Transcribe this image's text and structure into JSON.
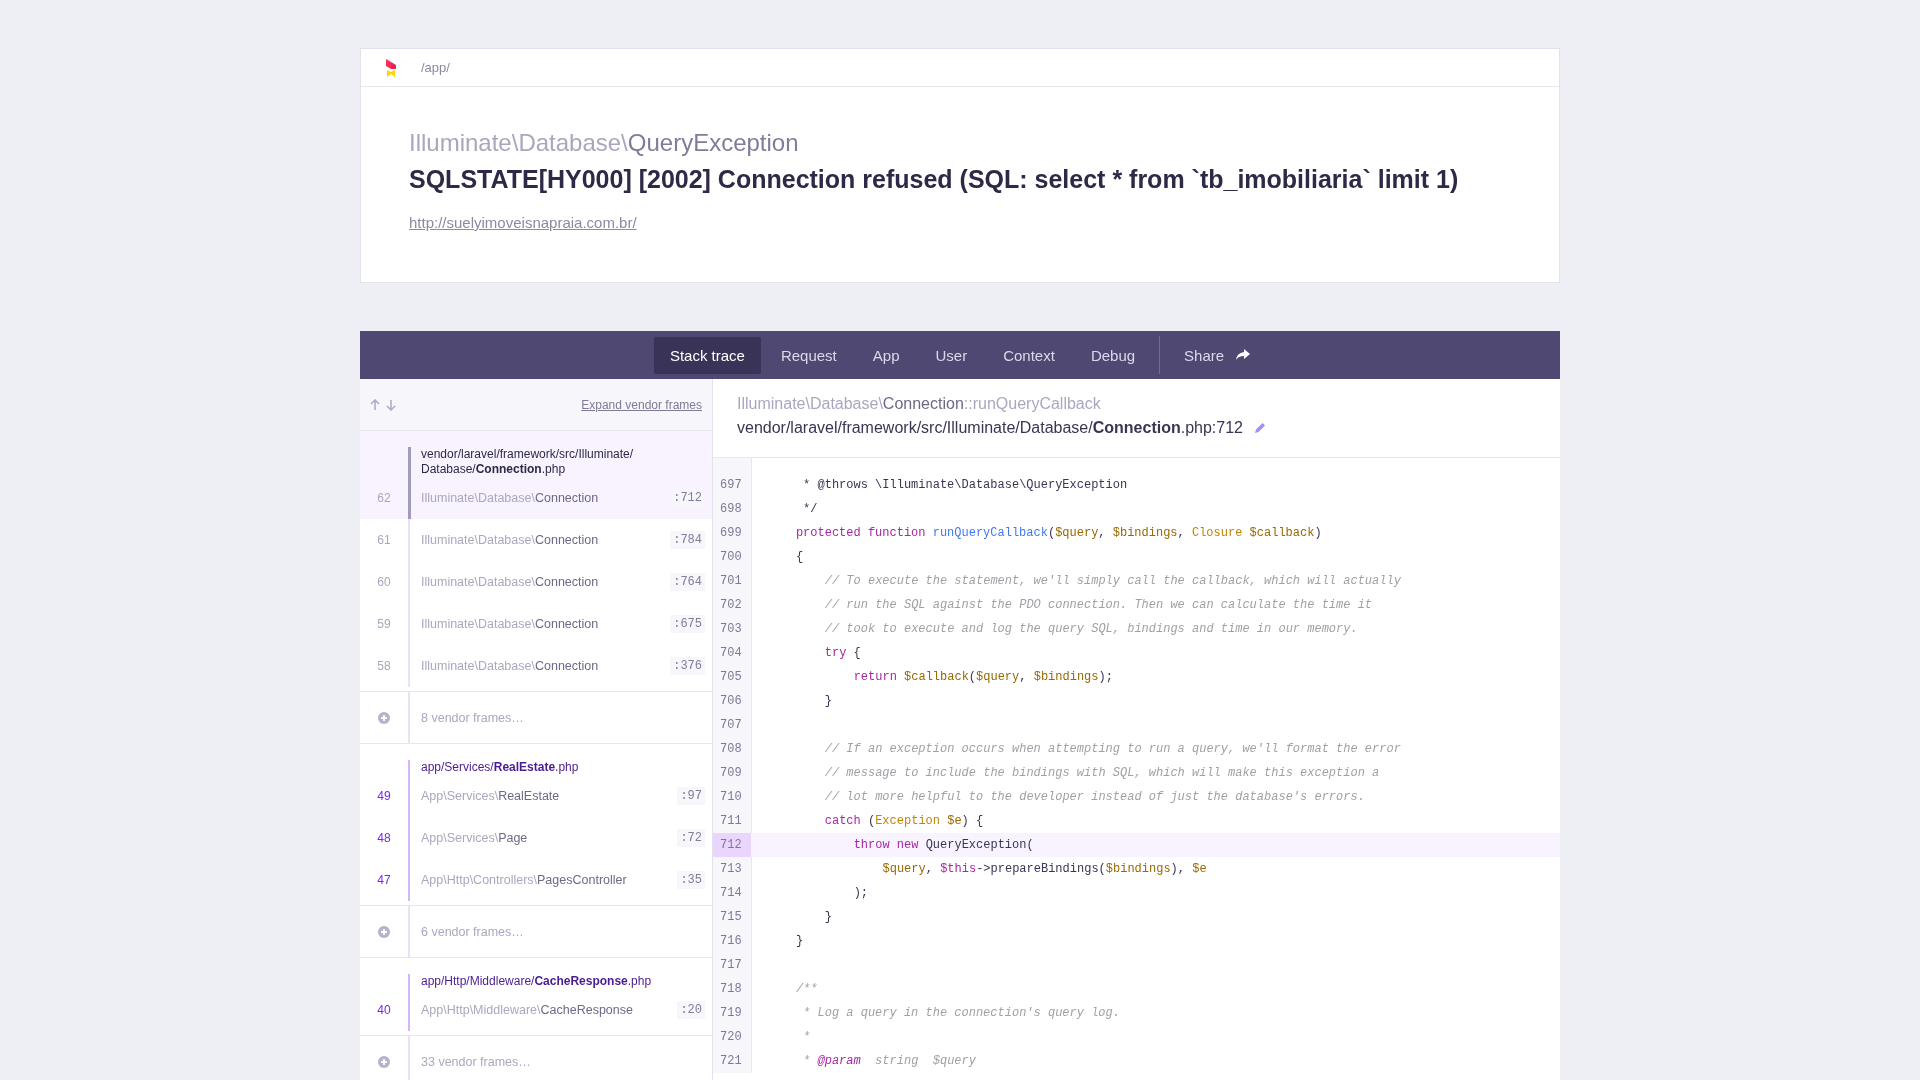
{
  "header": {
    "path": "/app/",
    "exception_namespace": "Illuminate\\Database\\",
    "exception_class": "QueryException",
    "message": "SQLSTATE[HY000] [2002] Connection refused (SQL: select * from `tb_imobiliaria` limit 1)",
    "url": "http://suelyimoveisnapraia.com.br/"
  },
  "tabs": [
    {
      "label": "Stack trace",
      "selected": true
    },
    {
      "label": "Request",
      "selected": false
    },
    {
      "label": "App",
      "selected": false
    },
    {
      "label": "User",
      "selected": false
    },
    {
      "label": "Context",
      "selected": false
    },
    {
      "label": "Debug",
      "selected": false
    }
  ],
  "share": {
    "label": "Share"
  },
  "stack": {
    "expand_label": "Expand vendor frames",
    "items": [
      {
        "kind": "frames",
        "app": false,
        "frames": [
          {
            "number": "62",
            "file": "vendor/laravel/framework/src/Illuminate/Database/**Connection**.php",
            "class_prefix": "Illuminate\\Database\\",
            "class_name": "Connection",
            "line": ":712",
            "selected": true
          },
          {
            "number": "61",
            "class_prefix": "Illuminate\\Database\\",
            "class_name": "Connection",
            "line": ":784",
            "selected": false
          },
          {
            "number": "60",
            "class_prefix": "Illuminate\\Database\\",
            "class_name": "Connection",
            "line": ":764",
            "selected": false
          },
          {
            "number": "59",
            "class_prefix": "Illuminate\\Database\\",
            "class_name": "Connection",
            "line": ":675",
            "selected": false
          },
          {
            "number": "58",
            "class_prefix": "Illuminate\\Database\\",
            "class_name": "Connection",
            "line": ":376",
            "selected": false
          }
        ]
      },
      {
        "kind": "vendor",
        "label": "8 vendor frames…"
      },
      {
        "kind": "frames",
        "app": true,
        "frames": [
          {
            "number": "49",
            "file": "app/Services/**RealEstate**.php",
            "class_prefix": "App\\Services\\",
            "class_name": "RealEstate",
            "line": ":97",
            "selected": false
          },
          {
            "number": "48",
            "class_prefix": "App\\Services\\",
            "class_name": "Page",
            "line": ":72",
            "selected": false
          },
          {
            "number": "47",
            "class_prefix": "App\\Http\\Controllers\\",
            "class_name": "PagesController",
            "line": ":35",
            "selected": false
          }
        ]
      },
      {
        "kind": "vendor",
        "label": "6 vendor frames…"
      },
      {
        "kind": "frames",
        "app": true,
        "frames": [
          {
            "number": "40",
            "file": "app/Http/Middleware/**CacheResponse**.php",
            "class_prefix": "App\\Http\\Middleware\\",
            "class_name": "CacheResponse",
            "line": ":20",
            "selected": false
          }
        ]
      },
      {
        "kind": "vendor",
        "label": "33 vendor frames…"
      }
    ]
  },
  "source": {
    "class_prefix": "Illuminate\\Database\\",
    "class_name": "Connection",
    "method": "::runQueryCallback",
    "file": "vendor/laravel/framework/src/Illuminate/Database/**Connection**.php:712",
    "lines": [
      {
        "number": "697",
        "highlighted": false,
        "tokens": [
          {
            "kind": "plain",
            "text": "     * @throws \\Illuminate\\Database\\QueryException"
          }
        ]
      },
      {
        "number": "698",
        "highlighted": false,
        "tokens": [
          {
            "kind": "plain",
            "text": "     */"
          }
        ]
      },
      {
        "number": "699",
        "highlighted": false,
        "tokens": [
          {
            "kind": "keyword",
            "text": "    protected function"
          },
          {
            "kind": "function",
            "text": " runQueryCallback"
          },
          {
            "kind": "plain",
            "text": "("
          },
          {
            "kind": "variable",
            "text": "$query"
          },
          {
            "kind": "plain",
            "text": ", "
          },
          {
            "kind": "variable",
            "text": "$bindings"
          },
          {
            "kind": "plain",
            "text": ", "
          },
          {
            "kind": "type",
            "text": "Closure"
          },
          {
            "kind": "variable",
            "text": " $callback"
          },
          {
            "kind": "plain",
            "text": ")"
          }
        ]
      },
      {
        "number": "700",
        "highlighted": false,
        "tokens": [
          {
            "kind": "plain",
            "text": "    {"
          }
        ]
      },
      {
        "number": "701",
        "highlighted": false,
        "tokens": [
          {
            "kind": "comment",
            "text": "        // To execute the statement, we'll simply call the callback, which will actually"
          }
        ]
      },
      {
        "number": "702",
        "highlighted": false,
        "tokens": [
          {
            "kind": "comment",
            "text": "        // run the SQL against the PDO connection. Then we can calculate the time it"
          }
        ]
      },
      {
        "number": "703",
        "highlighted": false,
        "tokens": [
          {
            "kind": "comment",
            "text": "        // took to execute and log the query SQL, bindings and time in our memory."
          }
        ]
      },
      {
        "number": "704",
        "highlighted": false,
        "tokens": [
          {
            "kind": "keyword",
            "text": "        try"
          },
          {
            "kind": "plain",
            "text": " {"
          }
        ]
      },
      {
        "number": "705",
        "highlighted": false,
        "tokens": [
          {
            "kind": "keyword",
            "text": "            return"
          },
          {
            "kind": "variable",
            "text": " $callback"
          },
          {
            "kind": "plain",
            "text": "("
          },
          {
            "kind": "variable",
            "text": "$query"
          },
          {
            "kind": "plain",
            "text": ", "
          },
          {
            "kind": "variable",
            "text": "$bindings"
          },
          {
            "kind": "plain",
            "text": ");"
          }
        ]
      },
      {
        "number": "706",
        "highlighted": false,
        "tokens": [
          {
            "kind": "plain",
            "text": "        }"
          }
        ]
      },
      {
        "number": "707",
        "highlighted": false
      },
      {
        "number": "708",
        "highlighted": false,
        "tokens": [
          {
            "kind": "comment",
            "text": "        // If an exception occurs when attempting to run a query, we'll format the error"
          }
        ]
      },
      {
        "number": "709",
        "highlighted": false,
        "tokens": [
          {
            "kind": "comment",
            "text": "        // message to include the bindings with SQL, which will make this exception a"
          }
        ]
      },
      {
        "number": "710",
        "highlighted": false,
        "tokens": [
          {
            "kind": "comment",
            "text": "        // lot more helpful to the developer instead of just the database's errors."
          }
        ]
      },
      {
        "number": "711",
        "highlighted": false,
        "tokens": [
          {
            "kind": "keyword",
            "text": "        catch"
          },
          {
            "kind": "plain",
            "text": " ("
          },
          {
            "kind": "type",
            "text": "Exception"
          },
          {
            "kind": "variable",
            "text": " $e"
          },
          {
            "kind": "plain",
            "text": ") {"
          }
        ]
      },
      {
        "number": "712",
        "highlighted": true,
        "tokens": [
          {
            "kind": "keyword",
            "text": "            throw new"
          },
          {
            "kind": "plain",
            "text": " QueryException("
          }
        ]
      },
      {
        "number": "713",
        "highlighted": false,
        "tokens": [
          {
            "kind": "variable",
            "text": "                $query"
          },
          {
            "kind": "plain",
            "text": ", "
          },
          {
            "kind": "keyword",
            "text": "$this"
          },
          {
            "kind": "plain",
            "text": "->prepareBindings("
          },
          {
            "kind": "variable",
            "text": "$bindings"
          },
          {
            "kind": "plain",
            "text": "), "
          },
          {
            "kind": "variable",
            "text": "$e"
          }
        ]
      },
      {
        "number": "714",
        "highlighted": false,
        "tokens": [
          {
            "kind": "plain",
            "text": "            );"
          }
        ]
      },
      {
        "number": "715",
        "highlighted": false,
        "tokens": [
          {
            "kind": "plain",
            "text": "        }"
          }
        ]
      },
      {
        "number": "716",
        "highlighted": false,
        "tokens": [
          {
            "kind": "plain",
            "text": "    }"
          }
        ]
      },
      {
        "number": "717",
        "highlighted": false
      },
      {
        "number": "718",
        "highlighted": false,
        "tokens": [
          {
            "kind": "comment",
            "text": "    /**"
          }
        ]
      },
      {
        "number": "719",
        "highlighted": false,
        "tokens": [
          {
            "kind": "comment",
            "text": "     * Log a query in the connection's query log."
          }
        ]
      },
      {
        "number": "720",
        "highlighted": false,
        "tokens": [
          {
            "kind": "comment",
            "text": "     *"
          }
        ]
      },
      {
        "number": "721",
        "highlighted": false,
        "tokens": [
          {
            "kind": "comment",
            "text": "     * "
          },
          {
            "kind": "tag",
            "text": "@param"
          },
          {
            "kind": "comment",
            "text": "  string  $query"
          }
        ]
      }
    ]
  }
}
